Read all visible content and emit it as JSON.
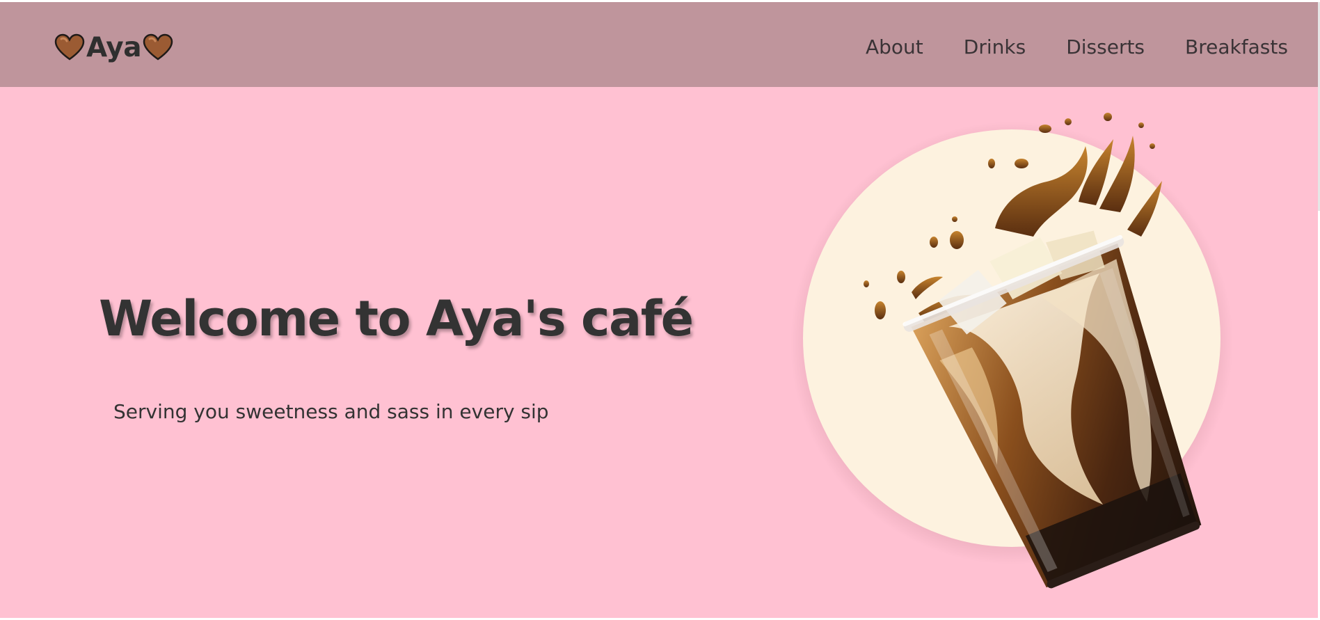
{
  "brand": {
    "name": "Aya",
    "left_icon": "heart-icon",
    "right_icon": "heart-icon",
    "heart_color": "#9b5b33"
  },
  "nav": {
    "items": [
      {
        "label": "About"
      },
      {
        "label": "Drinks"
      },
      {
        "label": "Disserts"
      },
      {
        "label": "Breakfasts"
      }
    ]
  },
  "hero": {
    "title": "Welcome to Aya's café",
    "subtitle": "Serving you sweetness and sass in every sip",
    "image": "iced-coffee-splash-image"
  },
  "colors": {
    "navbar_bg": "#bf959c",
    "hero_bg": "#ffc1d2",
    "circle_bg": "#fdf2df",
    "text": "#333333"
  }
}
